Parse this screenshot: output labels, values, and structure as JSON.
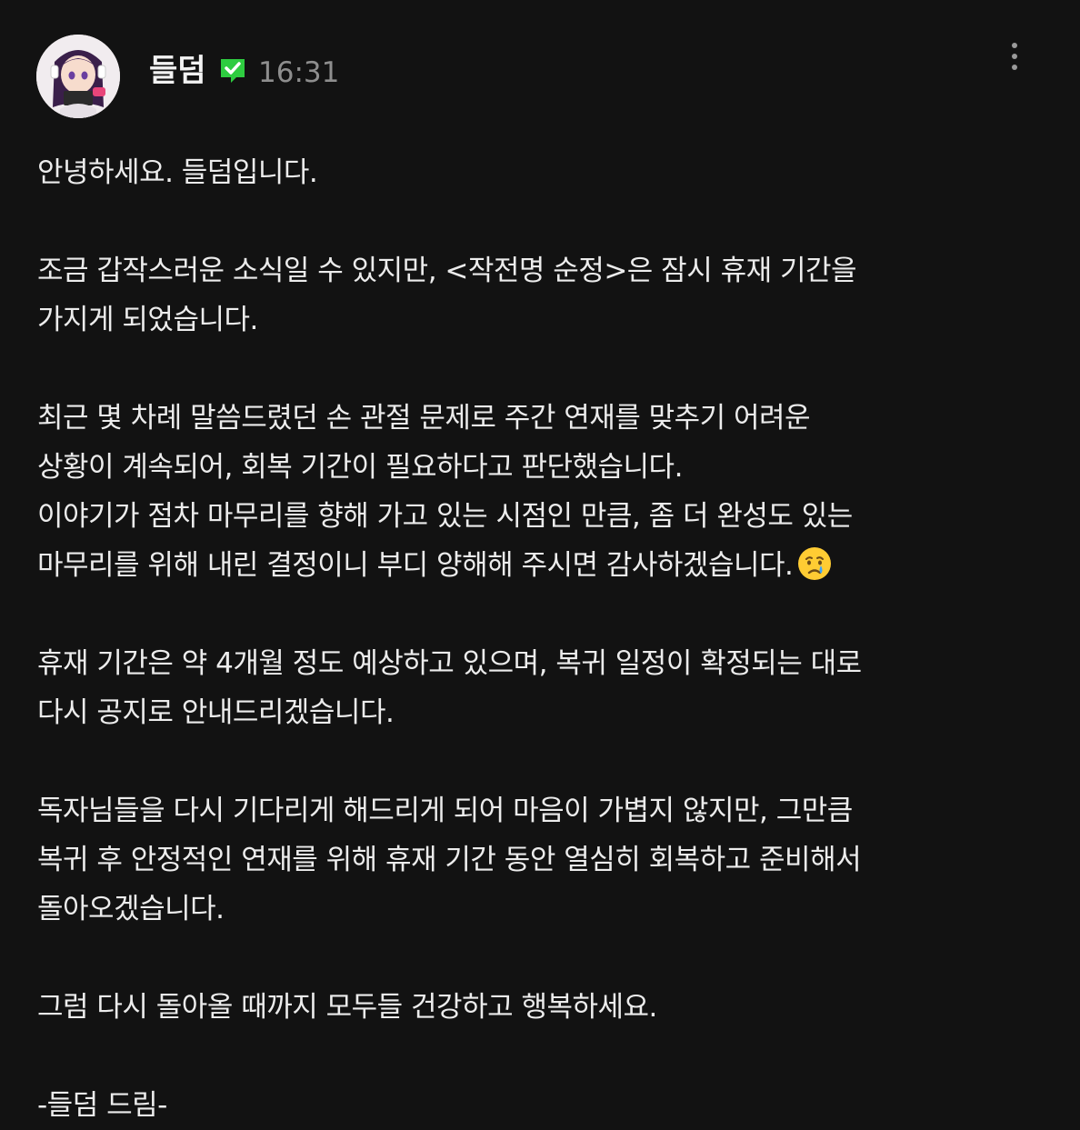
{
  "author": {
    "name": "들덤",
    "verified_icon": "verified-check-icon",
    "time": "16:31",
    "avatar_icon": "anime-avatar"
  },
  "more_menu_icon": "more-vertical-icon",
  "post": {
    "paragraphs": [
      {
        "lines": [
          "안녕하세요. 들덤입니다."
        ]
      },
      {
        "lines": [
          "조금 갑작스러운 소식일 수 있지만, <작전명 순정>은 잠시 휴재 기간을",
          "가지게 되었습니다."
        ]
      },
      {
        "lines": [
          "최근 몇 차례 말씀드렸던 손 관절 문제로 주간 연재를 맞추기 어려운",
          "상황이 계속되어, 회복 기간이 필요하다고 판단했습니다.",
          "이야기가 점차 마무리를 향해 가고 있는 시점인 만큼, 좀 더 완성도 있는",
          "마무리를 위해 내린 결정이니 부디 양해해 주시면 감사하겠습니다."
        ]
      },
      {
        "lines": [
          "휴재 기간은 약 4개월 정도 예상하고 있으며, 복귀 일정이 확정되는 대로",
          "다시 공지로 안내드리겠습니다."
        ]
      },
      {
        "lines": [
          "독자님들을 다시 기다리게 해드리게 되어 마음이 가볍지 않지만, 그만큼",
          "복귀 후 안정적인 연재를 위해 휴재 기간 동안 열심히 회복하고 준비해서",
          "돌아오겠습니다."
        ]
      },
      {
        "lines": [
          "그럼 다시 돌아올 때까지 모두들 건강하고 행복하세요."
        ]
      },
      {
        "lines": [
          "-들덤 드림-"
        ]
      }
    ],
    "emoji": "crying-face-emoji"
  },
  "colors": {
    "background": "#121212",
    "text": "#ececec",
    "time": "#8e8e8e",
    "verified_badge": "#2ecc40"
  }
}
